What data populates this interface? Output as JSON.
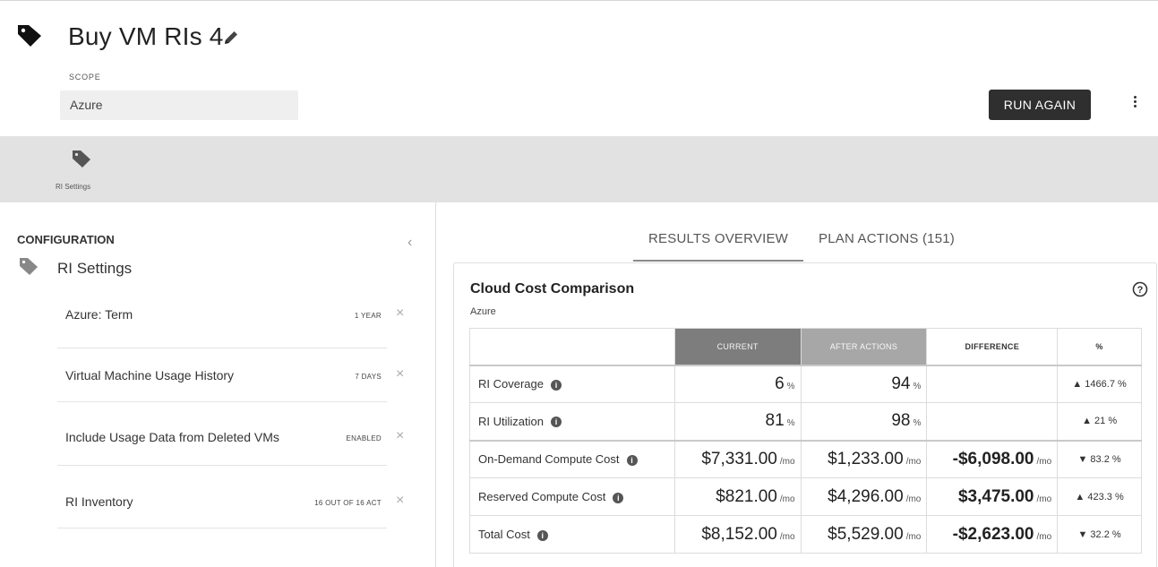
{
  "header": {
    "title": "Buy VM RIs 4",
    "scope_label": "SCOPE",
    "scope_value": "Azure",
    "run_again_label": "RUN AGAIN"
  },
  "strip": {
    "items": [
      {
        "label": "RI Settings",
        "icon": "tag-icon"
      }
    ]
  },
  "left_panel": {
    "title": "CONFIGURATION",
    "section_title": "RI Settings",
    "settings": [
      {
        "name": "Azure: Term",
        "value": "1 YEAR"
      },
      {
        "name": "Virtual Machine Usage History",
        "value": "7 DAYS"
      },
      {
        "name": "Include Usage Data from Deleted VMs",
        "value": "ENABLED"
      },
      {
        "name": "RI Inventory",
        "value": "16 OUT OF 16 ACT"
      }
    ]
  },
  "tabs": [
    {
      "label": "RESULTS OVERVIEW",
      "active": true
    },
    {
      "label": "PLAN ACTIONS (151)",
      "active": false
    }
  ],
  "card": {
    "title": "Cloud Cost Comparison",
    "subtitle": "Azure",
    "columns": [
      "CURRENT",
      "AFTER ACTIONS",
      "DIFFERENCE",
      "%"
    ],
    "rows": [
      {
        "label": "RI Coverage",
        "current": "6",
        "current_unit": "%",
        "after": "94",
        "after_unit": "%",
        "diff": "",
        "diff_unit": "",
        "pct": "▲ 1466.7 %"
      },
      {
        "label": "RI Utilization",
        "current": "81",
        "current_unit": "%",
        "after": "98",
        "after_unit": "%",
        "diff": "",
        "diff_unit": "",
        "pct": "▲ 21 %"
      },
      {
        "label": "On-Demand Compute Cost",
        "current": "$7,331.00",
        "current_unit": "/mo",
        "after": "$1,233.00",
        "after_unit": "/mo",
        "diff": "-$6,098.00",
        "diff_unit": "/mo",
        "pct": "▼ 83.2 %"
      },
      {
        "label": "Reserved Compute Cost",
        "current": "$821.00",
        "current_unit": "/mo",
        "after": "$4,296.00",
        "after_unit": "/mo",
        "diff": "$3,475.00",
        "diff_unit": "/mo",
        "pct": "▲ 423.3 %"
      },
      {
        "label": "Total Cost",
        "current": "$8,152.00",
        "current_unit": "/mo",
        "after": "$5,529.00",
        "after_unit": "/mo",
        "diff": "-$2,623.00",
        "diff_unit": "/mo",
        "pct": "▼ 32.2 %"
      }
    ]
  },
  "icons": {
    "title_icon": "tag-icon",
    "edit_icon": "pencil-icon",
    "menu_icon": "kebab-menu-icon",
    "collapse_icon": "chevron-left-icon",
    "help_icon": "question-circle-icon",
    "info_icon": "info-icon",
    "remove_icon": "close-icon"
  }
}
